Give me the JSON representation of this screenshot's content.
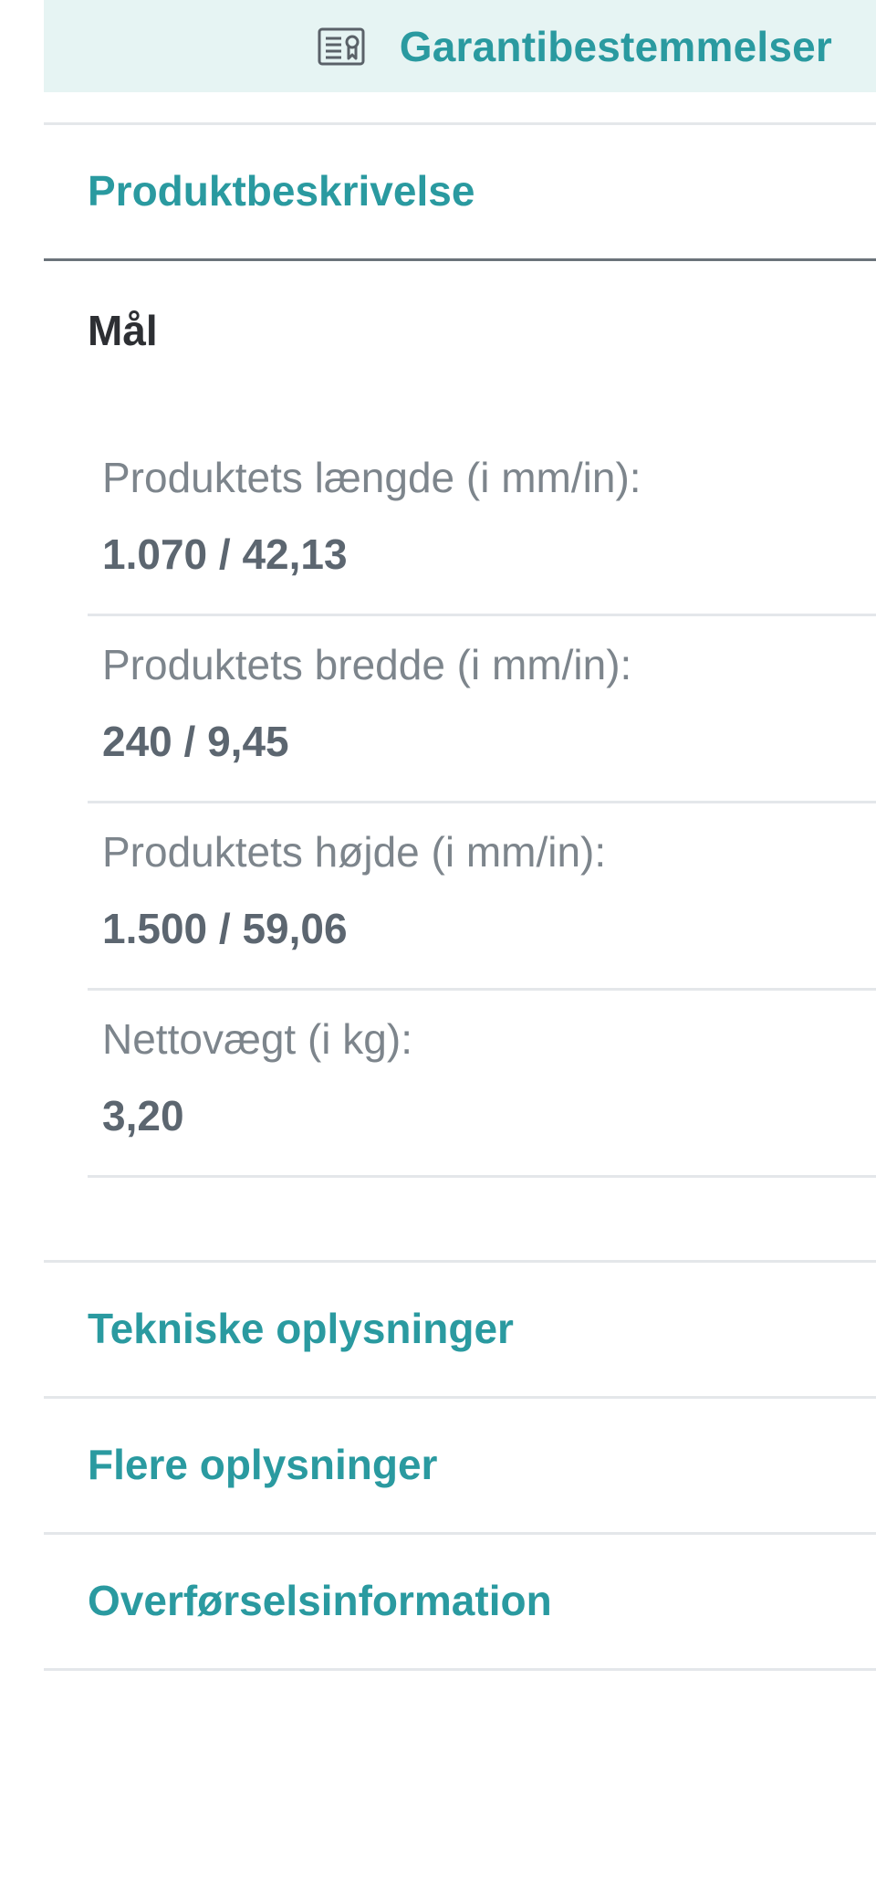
{
  "warranty": {
    "icon": "certificate-icon",
    "label": "Garantibestemmelser"
  },
  "accordion": {
    "product_description": "Produktbeskrivelse",
    "technical_info": "Tekniske oplysninger",
    "more_info": "Flere oplysninger",
    "transfer_info": "Overførselsinformation"
  },
  "dimensions": {
    "title": "Mål",
    "rows": [
      {
        "label": "Produktets længde (i mm/in):",
        "value": "1.070 / 42,13"
      },
      {
        "label": "Produktets bredde (i mm/in):",
        "value": "240 / 9,45"
      },
      {
        "label": "Produktets højde (i mm/in):",
        "value": "1.500 / 59,06"
      },
      {
        "label": "Nettovægt (i kg):",
        "value": "3,20"
      }
    ]
  },
  "colors": {
    "accent": "#2a9aa0",
    "banner_bg": "#e6f4f3",
    "divider": "#e4e7ea"
  }
}
